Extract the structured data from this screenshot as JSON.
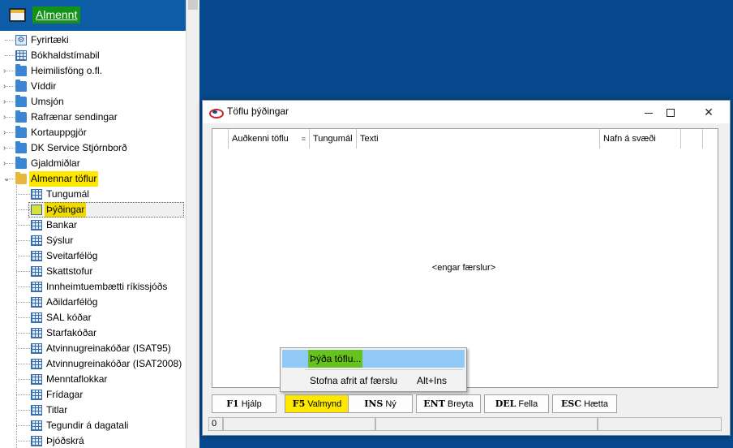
{
  "nav": {
    "title": "Almennt",
    "tree": [
      {
        "label": "Fyrirtæki",
        "icon": "gear-icon",
        "level": 0,
        "expandable": false
      },
      {
        "label": "Bókhaldstímabil",
        "icon": "table-icon",
        "level": 0,
        "expandable": false
      },
      {
        "label": "Heimilisföng o.fl.",
        "icon": "folder-icon",
        "level": 0,
        "expandable": true
      },
      {
        "label": "Víddir",
        "icon": "folder-icon",
        "level": 0,
        "expandable": true
      },
      {
        "label": "Umsjón",
        "icon": "folder-icon",
        "level": 0,
        "expandable": true
      },
      {
        "label": "Rafrænar sendingar",
        "icon": "folder-icon",
        "level": 0,
        "expandable": true
      },
      {
        "label": "Kortauppgjör",
        "icon": "folder-icon",
        "level": 0,
        "expandable": true
      },
      {
        "label": "DK Service Stjórnborð",
        "icon": "folder-icon",
        "level": 0,
        "expandable": true
      },
      {
        "label": "Gjaldmiðlar",
        "icon": "folder-icon",
        "level": 0,
        "expandable": true
      },
      {
        "label": "Almennar töflur",
        "icon": "folder-open-icon",
        "level": 0,
        "expandable": true,
        "expanded": true,
        "highlighted": true
      },
      {
        "label": "Tungumál",
        "icon": "table-icon",
        "level": 1
      },
      {
        "label": "Þýðingar",
        "icon": "table-icon",
        "level": 1,
        "selected": true
      },
      {
        "label": "Bankar",
        "icon": "table-icon",
        "level": 1
      },
      {
        "label": "Sýslur",
        "icon": "table-icon",
        "level": 1
      },
      {
        "label": "Sveitarfélög",
        "icon": "table-icon",
        "level": 1
      },
      {
        "label": "Skattstofur",
        "icon": "table-icon",
        "level": 1
      },
      {
        "label": "Innheimtuembætti ríkissjóðs",
        "icon": "table-icon",
        "level": 1
      },
      {
        "label": "Aðildarfélög",
        "icon": "table-icon",
        "level": 1
      },
      {
        "label": "SAL kóðar",
        "icon": "table-icon",
        "level": 1
      },
      {
        "label": "Starfakóðar",
        "icon": "table-icon",
        "level": 1
      },
      {
        "label": "Atvinnugreinakóðar (ISAT95)",
        "icon": "table-icon",
        "level": 1
      },
      {
        "label": "Atvinnugreinakóðar (ISAT2008)",
        "icon": "table-icon",
        "level": 1
      },
      {
        "label": "Menntaflokkar",
        "icon": "table-icon",
        "level": 1
      },
      {
        "label": "Frídagar",
        "icon": "table-icon",
        "level": 1
      },
      {
        "label": "Titlar",
        "icon": "table-icon",
        "level": 1
      },
      {
        "label": "Tegundir á dagatali",
        "icon": "table-icon",
        "level": 1
      },
      {
        "label": "Þjóðskrá",
        "icon": "table-icon",
        "level": 1
      }
    ]
  },
  "dialog": {
    "title": "Töflu þýðingar",
    "columns": [
      "Auðkenni töflu",
      "Tungumál",
      "Texti",
      "Nafn á svæði"
    ],
    "empty_text": "<engar færslur>",
    "fkeys": [
      {
        "key": "F1",
        "label": "Hjálp"
      },
      {
        "key": "F5",
        "label": "Valmynd"
      },
      {
        "key": "INS",
        "label": "Ný"
      },
      {
        "key": "ENT",
        "label": "Breyta"
      },
      {
        "key": "DEL",
        "label": "Fella"
      },
      {
        "key": "ESC",
        "label": "Hætta"
      }
    ],
    "status": [
      "0",
      "",
      "",
      ""
    ]
  },
  "context_menu": {
    "items": [
      {
        "label": "Þýða töflu...",
        "shortcut": ""
      },
      {
        "label": "Stofna afrit af færslu",
        "shortcut": "Alt+Ins"
      }
    ]
  },
  "colors": {
    "desktop": "#06498d",
    "nav_header": "#0d5ca8",
    "highlight_yellow": "#ffe800",
    "highlight_green": "#66c21c",
    "menu_hover": "#90c8f6"
  }
}
